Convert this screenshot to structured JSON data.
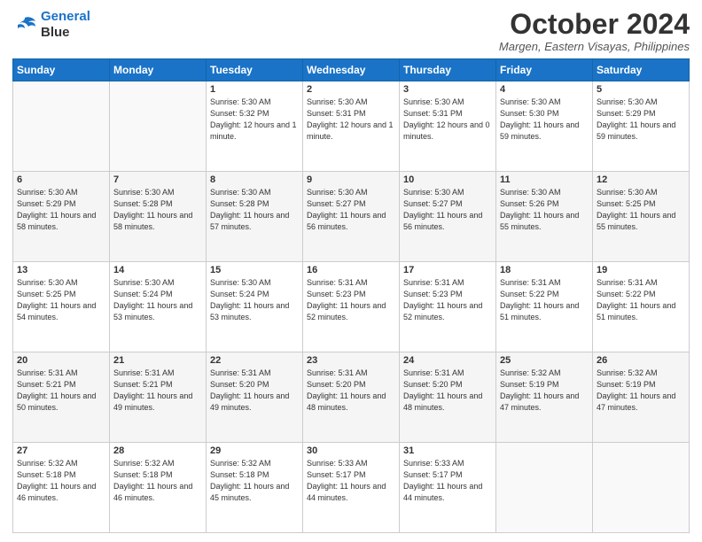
{
  "header": {
    "logo_line1": "General",
    "logo_line2": "Blue",
    "title": "October 2024",
    "subtitle": "Margen, Eastern Visayas, Philippines"
  },
  "days_of_week": [
    "Sunday",
    "Monday",
    "Tuesday",
    "Wednesday",
    "Thursday",
    "Friday",
    "Saturday"
  ],
  "weeks": [
    [
      {
        "day": "",
        "info": ""
      },
      {
        "day": "",
        "info": ""
      },
      {
        "day": "1",
        "info": "Sunrise: 5:30 AM\nSunset: 5:32 PM\nDaylight: 12 hours\nand 1 minute."
      },
      {
        "day": "2",
        "info": "Sunrise: 5:30 AM\nSunset: 5:31 PM\nDaylight: 12 hours\nand 1 minute."
      },
      {
        "day": "3",
        "info": "Sunrise: 5:30 AM\nSunset: 5:31 PM\nDaylight: 12 hours\nand 0 minutes."
      },
      {
        "day": "4",
        "info": "Sunrise: 5:30 AM\nSunset: 5:30 PM\nDaylight: 11 hours\nand 59 minutes."
      },
      {
        "day": "5",
        "info": "Sunrise: 5:30 AM\nSunset: 5:29 PM\nDaylight: 11 hours\nand 59 minutes."
      }
    ],
    [
      {
        "day": "6",
        "info": "Sunrise: 5:30 AM\nSunset: 5:29 PM\nDaylight: 11 hours\nand 58 minutes."
      },
      {
        "day": "7",
        "info": "Sunrise: 5:30 AM\nSunset: 5:28 PM\nDaylight: 11 hours\nand 58 minutes."
      },
      {
        "day": "8",
        "info": "Sunrise: 5:30 AM\nSunset: 5:28 PM\nDaylight: 11 hours\nand 57 minutes."
      },
      {
        "day": "9",
        "info": "Sunrise: 5:30 AM\nSunset: 5:27 PM\nDaylight: 11 hours\nand 56 minutes."
      },
      {
        "day": "10",
        "info": "Sunrise: 5:30 AM\nSunset: 5:27 PM\nDaylight: 11 hours\nand 56 minutes."
      },
      {
        "day": "11",
        "info": "Sunrise: 5:30 AM\nSunset: 5:26 PM\nDaylight: 11 hours\nand 55 minutes."
      },
      {
        "day": "12",
        "info": "Sunrise: 5:30 AM\nSunset: 5:25 PM\nDaylight: 11 hours\nand 55 minutes."
      }
    ],
    [
      {
        "day": "13",
        "info": "Sunrise: 5:30 AM\nSunset: 5:25 PM\nDaylight: 11 hours\nand 54 minutes."
      },
      {
        "day": "14",
        "info": "Sunrise: 5:30 AM\nSunset: 5:24 PM\nDaylight: 11 hours\nand 53 minutes."
      },
      {
        "day": "15",
        "info": "Sunrise: 5:30 AM\nSunset: 5:24 PM\nDaylight: 11 hours\nand 53 minutes."
      },
      {
        "day": "16",
        "info": "Sunrise: 5:31 AM\nSunset: 5:23 PM\nDaylight: 11 hours\nand 52 minutes."
      },
      {
        "day": "17",
        "info": "Sunrise: 5:31 AM\nSunset: 5:23 PM\nDaylight: 11 hours\nand 52 minutes."
      },
      {
        "day": "18",
        "info": "Sunrise: 5:31 AM\nSunset: 5:22 PM\nDaylight: 11 hours\nand 51 minutes."
      },
      {
        "day": "19",
        "info": "Sunrise: 5:31 AM\nSunset: 5:22 PM\nDaylight: 11 hours\nand 51 minutes."
      }
    ],
    [
      {
        "day": "20",
        "info": "Sunrise: 5:31 AM\nSunset: 5:21 PM\nDaylight: 11 hours\nand 50 minutes."
      },
      {
        "day": "21",
        "info": "Sunrise: 5:31 AM\nSunset: 5:21 PM\nDaylight: 11 hours\nand 49 minutes."
      },
      {
        "day": "22",
        "info": "Sunrise: 5:31 AM\nSunset: 5:20 PM\nDaylight: 11 hours\nand 49 minutes."
      },
      {
        "day": "23",
        "info": "Sunrise: 5:31 AM\nSunset: 5:20 PM\nDaylight: 11 hours\nand 48 minutes."
      },
      {
        "day": "24",
        "info": "Sunrise: 5:31 AM\nSunset: 5:20 PM\nDaylight: 11 hours\nand 48 minutes."
      },
      {
        "day": "25",
        "info": "Sunrise: 5:32 AM\nSunset: 5:19 PM\nDaylight: 11 hours\nand 47 minutes."
      },
      {
        "day": "26",
        "info": "Sunrise: 5:32 AM\nSunset: 5:19 PM\nDaylight: 11 hours\nand 47 minutes."
      }
    ],
    [
      {
        "day": "27",
        "info": "Sunrise: 5:32 AM\nSunset: 5:18 PM\nDaylight: 11 hours\nand 46 minutes."
      },
      {
        "day": "28",
        "info": "Sunrise: 5:32 AM\nSunset: 5:18 PM\nDaylight: 11 hours\nand 46 minutes."
      },
      {
        "day": "29",
        "info": "Sunrise: 5:32 AM\nSunset: 5:18 PM\nDaylight: 11 hours\nand 45 minutes."
      },
      {
        "day": "30",
        "info": "Sunrise: 5:33 AM\nSunset: 5:17 PM\nDaylight: 11 hours\nand 44 minutes."
      },
      {
        "day": "31",
        "info": "Sunrise: 5:33 AM\nSunset: 5:17 PM\nDaylight: 11 hours\nand 44 minutes."
      },
      {
        "day": "",
        "info": ""
      },
      {
        "day": "",
        "info": ""
      }
    ]
  ]
}
